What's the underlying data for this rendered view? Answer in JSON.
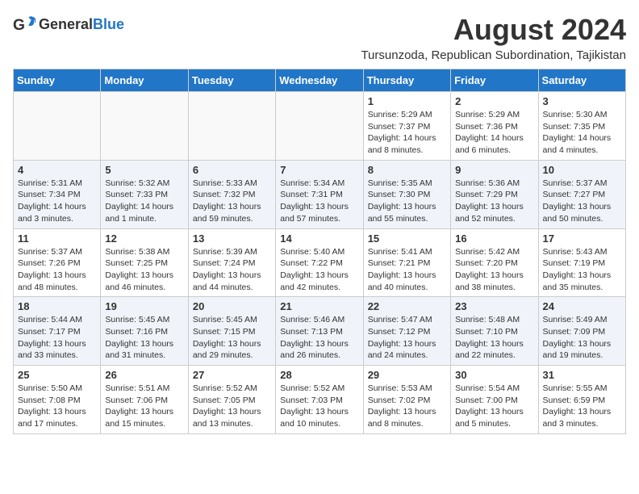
{
  "logo": {
    "general": "General",
    "blue": "Blue"
  },
  "title": {
    "month_year": "August 2024",
    "location": "Tursunzoda, Republican Subordination, Tajikistan"
  },
  "headers": [
    "Sunday",
    "Monday",
    "Tuesday",
    "Wednesday",
    "Thursday",
    "Friday",
    "Saturday"
  ],
  "weeks": [
    [
      {
        "day": "",
        "info": ""
      },
      {
        "day": "",
        "info": ""
      },
      {
        "day": "",
        "info": ""
      },
      {
        "day": "",
        "info": ""
      },
      {
        "day": "1",
        "info": "Sunrise: 5:29 AM\nSunset: 7:37 PM\nDaylight: 14 hours\nand 8 minutes."
      },
      {
        "day": "2",
        "info": "Sunrise: 5:29 AM\nSunset: 7:36 PM\nDaylight: 14 hours\nand 6 minutes."
      },
      {
        "day": "3",
        "info": "Sunrise: 5:30 AM\nSunset: 7:35 PM\nDaylight: 14 hours\nand 4 minutes."
      }
    ],
    [
      {
        "day": "4",
        "info": "Sunrise: 5:31 AM\nSunset: 7:34 PM\nDaylight: 14 hours\nand 3 minutes."
      },
      {
        "day": "5",
        "info": "Sunrise: 5:32 AM\nSunset: 7:33 PM\nDaylight: 14 hours\nand 1 minute."
      },
      {
        "day": "6",
        "info": "Sunrise: 5:33 AM\nSunset: 7:32 PM\nDaylight: 13 hours\nand 59 minutes."
      },
      {
        "day": "7",
        "info": "Sunrise: 5:34 AM\nSunset: 7:31 PM\nDaylight: 13 hours\nand 57 minutes."
      },
      {
        "day": "8",
        "info": "Sunrise: 5:35 AM\nSunset: 7:30 PM\nDaylight: 13 hours\nand 55 minutes."
      },
      {
        "day": "9",
        "info": "Sunrise: 5:36 AM\nSunset: 7:29 PM\nDaylight: 13 hours\nand 52 minutes."
      },
      {
        "day": "10",
        "info": "Sunrise: 5:37 AM\nSunset: 7:27 PM\nDaylight: 13 hours\nand 50 minutes."
      }
    ],
    [
      {
        "day": "11",
        "info": "Sunrise: 5:37 AM\nSunset: 7:26 PM\nDaylight: 13 hours\nand 48 minutes."
      },
      {
        "day": "12",
        "info": "Sunrise: 5:38 AM\nSunset: 7:25 PM\nDaylight: 13 hours\nand 46 minutes."
      },
      {
        "day": "13",
        "info": "Sunrise: 5:39 AM\nSunset: 7:24 PM\nDaylight: 13 hours\nand 44 minutes."
      },
      {
        "day": "14",
        "info": "Sunrise: 5:40 AM\nSunset: 7:22 PM\nDaylight: 13 hours\nand 42 minutes."
      },
      {
        "day": "15",
        "info": "Sunrise: 5:41 AM\nSunset: 7:21 PM\nDaylight: 13 hours\nand 40 minutes."
      },
      {
        "day": "16",
        "info": "Sunrise: 5:42 AM\nSunset: 7:20 PM\nDaylight: 13 hours\nand 38 minutes."
      },
      {
        "day": "17",
        "info": "Sunrise: 5:43 AM\nSunset: 7:19 PM\nDaylight: 13 hours\nand 35 minutes."
      }
    ],
    [
      {
        "day": "18",
        "info": "Sunrise: 5:44 AM\nSunset: 7:17 PM\nDaylight: 13 hours\nand 33 minutes."
      },
      {
        "day": "19",
        "info": "Sunrise: 5:45 AM\nSunset: 7:16 PM\nDaylight: 13 hours\nand 31 minutes."
      },
      {
        "day": "20",
        "info": "Sunrise: 5:45 AM\nSunset: 7:15 PM\nDaylight: 13 hours\nand 29 minutes."
      },
      {
        "day": "21",
        "info": "Sunrise: 5:46 AM\nSunset: 7:13 PM\nDaylight: 13 hours\nand 26 minutes."
      },
      {
        "day": "22",
        "info": "Sunrise: 5:47 AM\nSunset: 7:12 PM\nDaylight: 13 hours\nand 24 minutes."
      },
      {
        "day": "23",
        "info": "Sunrise: 5:48 AM\nSunset: 7:10 PM\nDaylight: 13 hours\nand 22 minutes."
      },
      {
        "day": "24",
        "info": "Sunrise: 5:49 AM\nSunset: 7:09 PM\nDaylight: 13 hours\nand 19 minutes."
      }
    ],
    [
      {
        "day": "25",
        "info": "Sunrise: 5:50 AM\nSunset: 7:08 PM\nDaylight: 13 hours\nand 17 minutes."
      },
      {
        "day": "26",
        "info": "Sunrise: 5:51 AM\nSunset: 7:06 PM\nDaylight: 13 hours\nand 15 minutes."
      },
      {
        "day": "27",
        "info": "Sunrise: 5:52 AM\nSunset: 7:05 PM\nDaylight: 13 hours\nand 13 minutes."
      },
      {
        "day": "28",
        "info": "Sunrise: 5:52 AM\nSunset: 7:03 PM\nDaylight: 13 hours\nand 10 minutes."
      },
      {
        "day": "29",
        "info": "Sunrise: 5:53 AM\nSunset: 7:02 PM\nDaylight: 13 hours\nand 8 minutes."
      },
      {
        "day": "30",
        "info": "Sunrise: 5:54 AM\nSunset: 7:00 PM\nDaylight: 13 hours\nand 5 minutes."
      },
      {
        "day": "31",
        "info": "Sunrise: 5:55 AM\nSunset: 6:59 PM\nDaylight: 13 hours\nand 3 minutes."
      }
    ]
  ]
}
